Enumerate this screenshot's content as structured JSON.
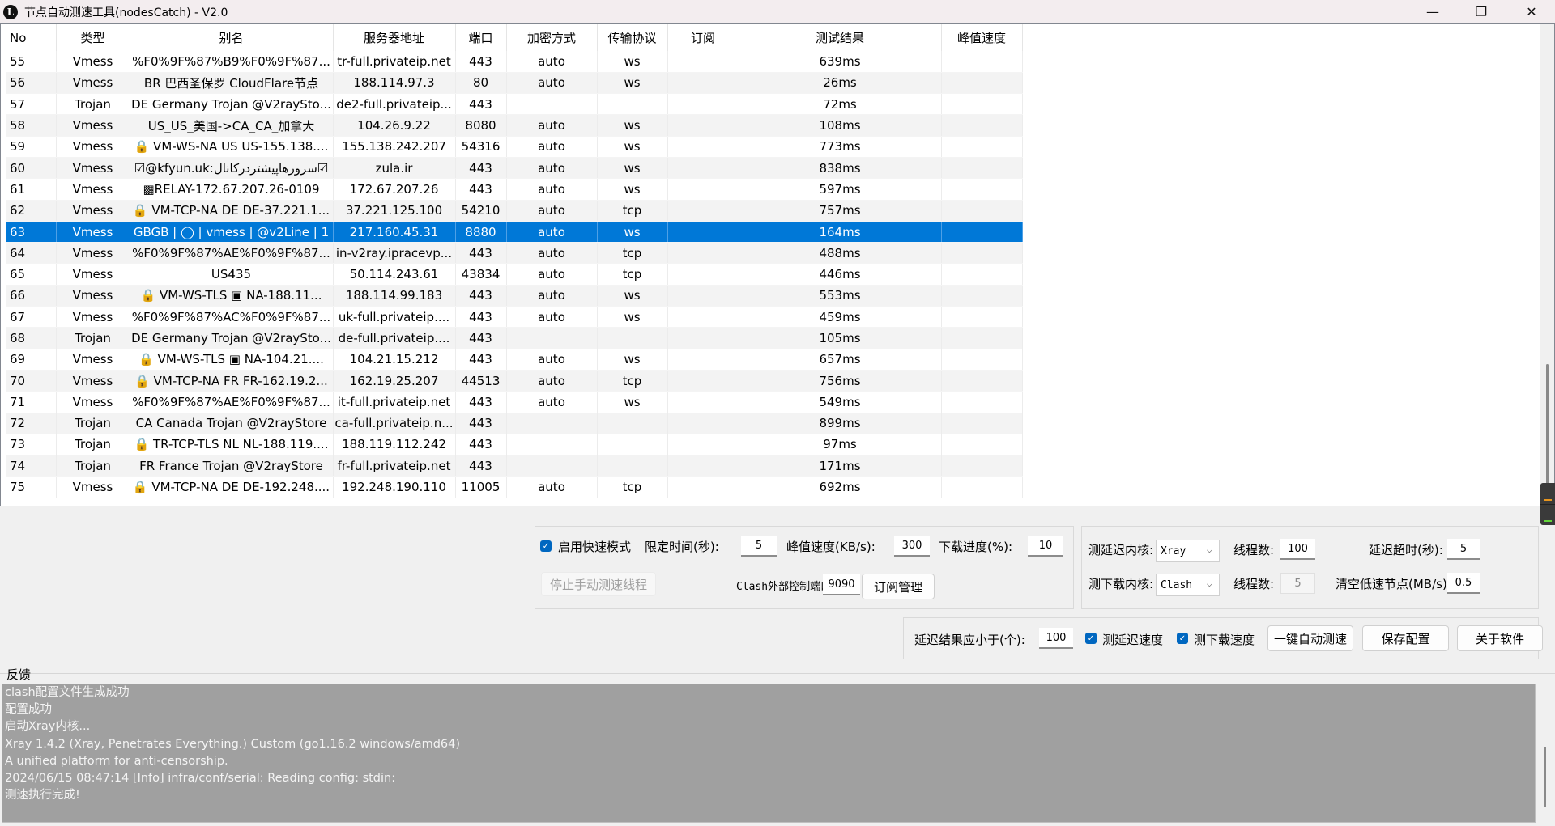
{
  "window": {
    "title": "节点自动测速工具(nodesCatch) - V2.0",
    "icon": "app-logo-icon",
    "controls": {
      "minimize": "—",
      "maximize": "❐",
      "close": "✕"
    }
  },
  "table": {
    "columns": [
      "No",
      "类型",
      "别名",
      "服务器地址",
      "端口",
      "加密方式",
      "传输协议",
      "订阅",
      "测试结果",
      "峰值速度"
    ],
    "selected_no": "63",
    "rows": [
      {
        "no": "55",
        "type": "Vmess",
        "alias": "%F0%9F%87%B9%F0%9F%87...",
        "server": "tr-full.privateip.net",
        "port": "443",
        "cipher": "auto",
        "transport": "ws",
        "sub": "",
        "result": "639ms",
        "peak": ""
      },
      {
        "no": "56",
        "type": "Vmess",
        "alias": "BR 巴西圣保罗 CloudFlare节点",
        "server": "188.114.97.3",
        "port": "80",
        "cipher": "auto",
        "transport": "ws",
        "sub": "",
        "result": "26ms",
        "peak": ""
      },
      {
        "no": "57",
        "type": "Trojan",
        "alias": "DE Germany Trojan @V2raySto...",
        "server": "de2-full.privateip...",
        "port": "443",
        "cipher": "",
        "transport": "",
        "sub": "",
        "result": "72ms",
        "peak": ""
      },
      {
        "no": "58",
        "type": "Vmess",
        "alias": "US_US_美国->CA_CA_加拿大",
        "server": "104.26.9.22",
        "port": "8080",
        "cipher": "auto",
        "transport": "ws",
        "sub": "",
        "result": "108ms",
        "peak": ""
      },
      {
        "no": "59",
        "type": "Vmess",
        "alias": "🔒 VM-WS-NA US US-155.138....",
        "server": "155.138.242.207",
        "port": "54316",
        "cipher": "auto",
        "transport": "ws",
        "sub": "",
        "result": "773ms",
        "peak": ""
      },
      {
        "no": "60",
        "type": "Vmess",
        "alias": "☑@kfyun.uk:سرورهاپیشتردرکانال☑",
        "server": "zula.ir",
        "port": "443",
        "cipher": "auto",
        "transport": "ws",
        "sub": "",
        "result": "838ms",
        "peak": ""
      },
      {
        "no": "61",
        "type": "Vmess",
        "alias": "▩RELAY-172.67.207.26-0109",
        "server": "172.67.207.26",
        "port": "443",
        "cipher": "auto",
        "transport": "ws",
        "sub": "",
        "result": "597ms",
        "peak": ""
      },
      {
        "no": "62",
        "type": "Vmess",
        "alias": "🔒 VM-TCP-NA DE DE-37.221.1...",
        "server": "37.221.125.100",
        "port": "54210",
        "cipher": "auto",
        "transport": "tcp",
        "sub": "",
        "result": "757ms",
        "peak": ""
      },
      {
        "no": "63",
        "type": "Vmess",
        "alias": "GBGB | ◯ | vmess | @v2Line | 1",
        "server": "217.160.45.31",
        "port": "8880",
        "cipher": "auto",
        "transport": "ws",
        "sub": "",
        "result": "164ms",
        "peak": ""
      },
      {
        "no": "64",
        "type": "Vmess",
        "alias": "%F0%9F%87%AE%F0%9F%87...",
        "server": "in-v2ray.ipracevp...",
        "port": "443",
        "cipher": "auto",
        "transport": "tcp",
        "sub": "",
        "result": "488ms",
        "peak": ""
      },
      {
        "no": "65",
        "type": "Vmess",
        "alias": "US435",
        "server": "50.114.243.61",
        "port": "43834",
        "cipher": "auto",
        "transport": "tcp",
        "sub": "",
        "result": "446ms",
        "peak": ""
      },
      {
        "no": "66",
        "type": "Vmess",
        "alias": "🔒 VM-WS-TLS ▣ NA-188.11...",
        "server": "188.114.99.183",
        "port": "443",
        "cipher": "auto",
        "transport": "ws",
        "sub": "",
        "result": "553ms",
        "peak": ""
      },
      {
        "no": "67",
        "type": "Vmess",
        "alias": "%F0%9F%87%AC%F0%9F%87...",
        "server": "uk-full.privateip....",
        "port": "443",
        "cipher": "auto",
        "transport": "ws",
        "sub": "",
        "result": "459ms",
        "peak": ""
      },
      {
        "no": "68",
        "type": "Trojan",
        "alias": "DE Germany Trojan @V2raySto...",
        "server": "de-full.privateip....",
        "port": "443",
        "cipher": "",
        "transport": "",
        "sub": "",
        "result": "105ms",
        "peak": ""
      },
      {
        "no": "69",
        "type": "Vmess",
        "alias": "🔒 VM-WS-TLS ▣ NA-104.21....",
        "server": "104.21.15.212",
        "port": "443",
        "cipher": "auto",
        "transport": "ws",
        "sub": "",
        "result": "657ms",
        "peak": ""
      },
      {
        "no": "70",
        "type": "Vmess",
        "alias": "🔒 VM-TCP-NA FR FR-162.19.2...",
        "server": "162.19.25.207",
        "port": "44513",
        "cipher": "auto",
        "transport": "tcp",
        "sub": "",
        "result": "756ms",
        "peak": ""
      },
      {
        "no": "71",
        "type": "Vmess",
        "alias": "%F0%9F%87%AE%F0%9F%87...",
        "server": "it-full.privateip.net",
        "port": "443",
        "cipher": "auto",
        "transport": "ws",
        "sub": "",
        "result": "549ms",
        "peak": ""
      },
      {
        "no": "72",
        "type": "Trojan",
        "alias": "CA Canada Trojan @V2rayStore",
        "server": "ca-full.privateip.n...",
        "port": "443",
        "cipher": "",
        "transport": "",
        "sub": "",
        "result": "899ms",
        "peak": ""
      },
      {
        "no": "73",
        "type": "Trojan",
        "alias": "🔒 TR-TCP-TLS NL NL-188.119....",
        "server": "188.119.112.242",
        "port": "443",
        "cipher": "",
        "transport": "",
        "sub": "",
        "result": "97ms",
        "peak": ""
      },
      {
        "no": "74",
        "type": "Trojan",
        "alias": "FR France Trojan @V2rayStore",
        "server": "fr-full.privateip.net",
        "port": "443",
        "cipher": "",
        "transport": "",
        "sub": "",
        "result": "171ms",
        "peak": ""
      },
      {
        "no": "75",
        "type": "Vmess",
        "alias": "🔒 VM-TCP-NA DE DE-192.248....",
        "server": "192.248.190.110",
        "port": "11005",
        "cipher": "auto",
        "transport": "tcp",
        "sub": "",
        "result": "692ms",
        "peak": ""
      }
    ]
  },
  "fast_mode": {
    "enable_label": "启用快速模式",
    "enabled": true,
    "time_limit_label": "限定时间(秒):",
    "time_limit_value": "5",
    "peak_speed_label": "峰值速度(KB/s):",
    "peak_speed_value": "300",
    "download_progress_label": "下载进度(%):",
    "download_progress_value": "10",
    "stop_button": "停止手动测速线程",
    "clash_port_label": "Clash外部控制端口:",
    "clash_port_value": "9090",
    "subscription_button": "订阅管理"
  },
  "cores": {
    "latency_core_label": "测延迟内核:",
    "latency_core_value": "Xray",
    "latency_threads_label": "线程数:",
    "latency_threads_value": "100",
    "latency_timeout_label": "延迟超时(秒):",
    "latency_timeout_value": "5",
    "download_core_label": "测下载内核:",
    "download_core_value": "Clash",
    "download_threads_label": "线程数:",
    "download_threads_value": "5",
    "clear_slow_label": "清空低速节点(MB/s):",
    "clear_slow_value": "0.5"
  },
  "actions": {
    "latency_limit_label": "延迟结果应小于(个):",
    "latency_limit_value": "100",
    "test_latency_label": "测延迟速度",
    "test_latency_checked": true,
    "test_download_label": "测下载速度",
    "test_download_checked": true,
    "auto_test_button": "一键自动测速",
    "save_config_button": "保存配置",
    "about_button": "关于软件"
  },
  "log": {
    "title": "反馈",
    "lines": [
      "clash配置文件生成成功",
      "配置成功",
      "启动Xray内核...",
      "Xray 1.4.2 (Xray, Penetrates Everything.) Custom (go1.16.2 windows/amd64)",
      "A unified platform for anti-censorship.",
      "2024/06/15 08:47:14 [Info] infra/conf/serial: Reading config: stdin:",
      "测速执行完成!"
    ]
  },
  "colors": {
    "selection": "#0078d7",
    "checkbox": "#0067c0",
    "log_background": "#a0a0a0"
  }
}
